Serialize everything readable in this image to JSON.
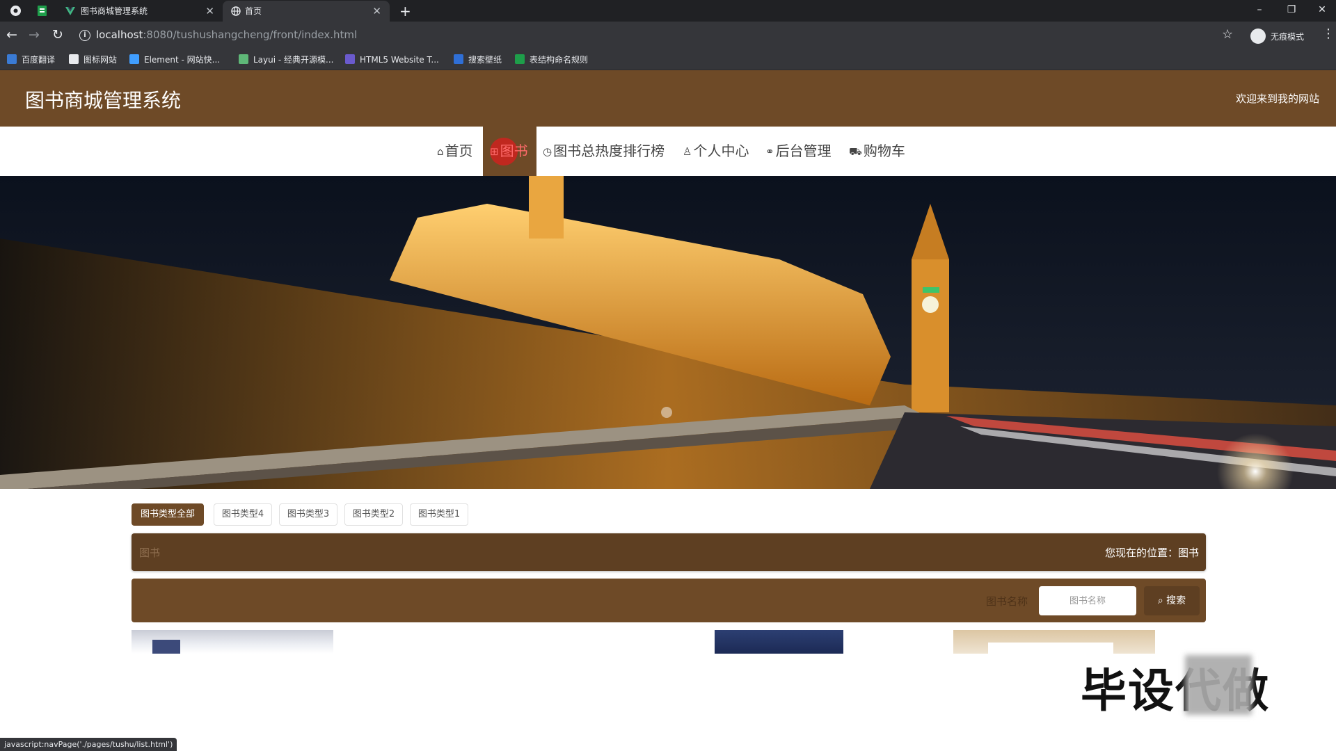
{
  "browser": {
    "tabs": [
      {
        "title": "图书商城管理系统",
        "active": false
      },
      {
        "title": "首页",
        "active": true
      }
    ],
    "url_host": "localhost",
    "url_rest": ":8080/tushushangcheng/front/index.html",
    "incognito_label": "无痕模式",
    "bookmarks": [
      "百度翻译",
      "图标网站",
      "Element - 网站快...",
      "Layui - 经典开源模...",
      "HTML5 Website T...",
      "搜索壁纸",
      "表结构命名规则"
    ],
    "status_url": "javascript:navPage('./pages/tushu/list.html')"
  },
  "site": {
    "title": "图书商城管理系统",
    "welcome": "欢迎来到我的网站"
  },
  "nav": {
    "items": [
      {
        "label": "首页",
        "icon": "home-icon"
      },
      {
        "label": "图书",
        "icon": "grid-icon",
        "active": true
      },
      {
        "label": "图书总热度排行榜",
        "icon": "clock-icon"
      },
      {
        "label": "个人中心",
        "icon": "user-icon"
      },
      {
        "label": "后台管理",
        "icon": "link-icon"
      },
      {
        "label": "购物车",
        "icon": "cart-icon"
      }
    ]
  },
  "banner": {
    "slides": 2,
    "current": 1
  },
  "categories": [
    "图书类型全部",
    "图书类型4",
    "图书类型3",
    "图书类型2",
    "图书类型1"
  ],
  "breadcrumb": {
    "section": "图书",
    "location_label": "您现在的位置：图书"
  },
  "search": {
    "label": "图书名称",
    "placeholder": "图书名称",
    "button": "搜索"
  },
  "watermark": "毕设代做",
  "colors": {
    "brand": "#6e4a27",
    "brand_dark": "#5e3f22",
    "nav_active_text": "#ff6b6b"
  }
}
